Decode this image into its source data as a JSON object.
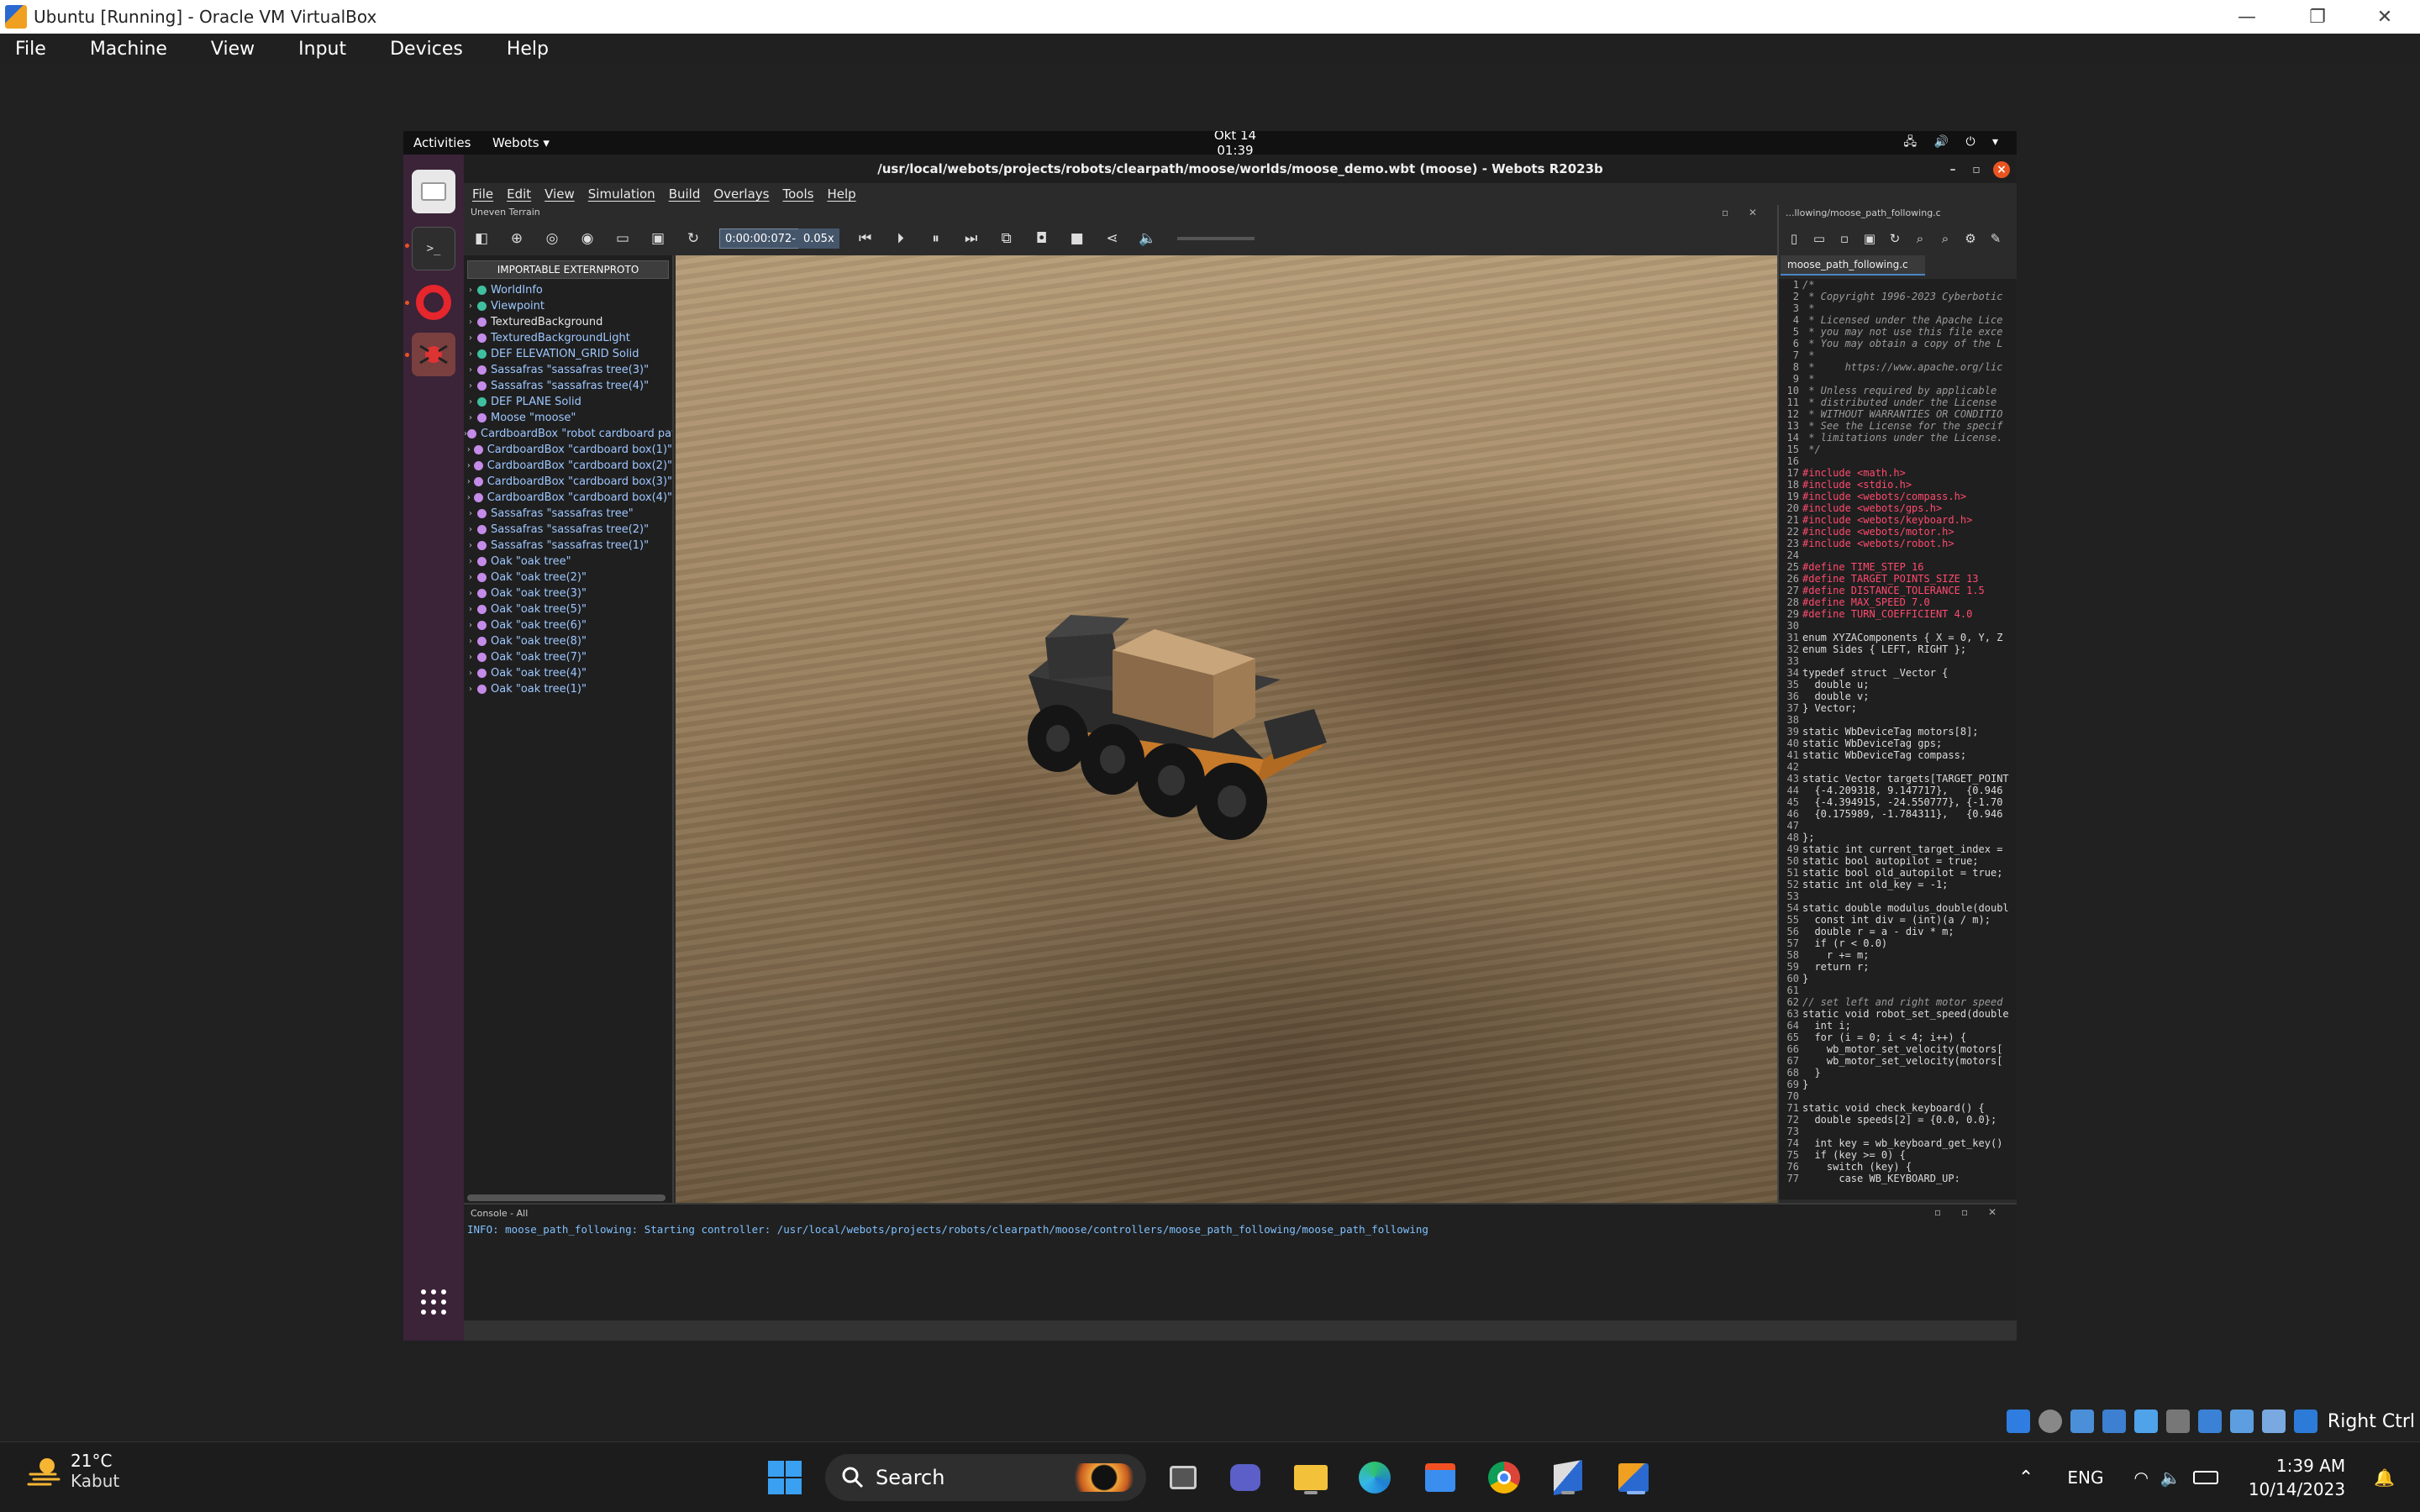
{
  "host": {
    "window_title": "Ubuntu [Running] - Oracle VM VirtualBox",
    "controls": [
      "—",
      "❐",
      "✕"
    ],
    "menu": [
      "File",
      "Machine",
      "View",
      "Input",
      "Devices",
      "Help"
    ],
    "right_ctrl": "Right Ctrl"
  },
  "guest": {
    "activities": "Activities",
    "app_menu": "Webots ▾",
    "clock": "Okt 14  01:39",
    "tray": "🖧 🔊 ⏻ ▾"
  },
  "webots": {
    "title": "/usr/local/webots/projects/robots/clearpath/moose/worlds/moose_demo.wbt (moose) - Webots R2023b",
    "menu": [
      "File",
      "Edit",
      "View",
      "Simulation",
      "Build",
      "Overlays",
      "Tools",
      "Help"
    ],
    "dock_label": "Uneven Terrain",
    "time": "0:00:00:072",
    "time_sep": "-",
    "speed": "0.05x",
    "importable_button": "IMPORTABLE EXTERNPROTO",
    "scene_tree": [
      {
        "label": "WorldInfo",
        "color": "#3fbfa0",
        "plain": false
      },
      {
        "label": "Viewpoint",
        "color": "#3fbfa0",
        "plain": false
      },
      {
        "label": "TexturedBackground",
        "color": "#c58be8",
        "plain": true
      },
      {
        "label": "TexturedBackgroundLight",
        "color": "#c58be8",
        "plain": false
      },
      {
        "label": "DEF ELEVATION_GRID Solid",
        "color": "#3fbfa0",
        "plain": false
      },
      {
        "label": "Sassafras \"sassafras tree(3)\"",
        "color": "#c58be8",
        "plain": false
      },
      {
        "label": "Sassafras \"sassafras tree(4)\"",
        "color": "#c58be8",
        "plain": false
      },
      {
        "label": "DEF PLANE Solid",
        "color": "#3fbfa0",
        "plain": false
      },
      {
        "label": "Moose \"moose\"",
        "color": "#c58be8",
        "plain": false
      },
      {
        "label": "CardboardBox \"robot cardboard pay",
        "color": "#c58be8",
        "plain": false
      },
      {
        "label": "CardboardBox \"cardboard box(1)\"",
        "color": "#c58be8",
        "plain": false
      },
      {
        "label": "CardboardBox \"cardboard box(2)\"",
        "color": "#c58be8",
        "plain": false
      },
      {
        "label": "CardboardBox \"cardboard box(3)\"",
        "color": "#c58be8",
        "plain": false
      },
      {
        "label": "CardboardBox \"cardboard box(4)\"",
        "color": "#c58be8",
        "plain": false
      },
      {
        "label": "Sassafras \"sassafras tree\"",
        "color": "#c58be8",
        "plain": false
      },
      {
        "label": "Sassafras \"sassafras tree(2)\"",
        "color": "#c58be8",
        "plain": false
      },
      {
        "label": "Sassafras \"sassafras tree(1)\"",
        "color": "#c58be8",
        "plain": false
      },
      {
        "label": "Oak \"oak tree\"",
        "color": "#c58be8",
        "plain": false
      },
      {
        "label": "Oak \"oak tree(2)\"",
        "color": "#c58be8",
        "plain": false
      },
      {
        "label": "Oak \"oak tree(3)\"",
        "color": "#c58be8",
        "plain": false
      },
      {
        "label": "Oak \"oak tree(5)\"",
        "color": "#c58be8",
        "plain": false
      },
      {
        "label": "Oak \"oak tree(6)\"",
        "color": "#c58be8",
        "plain": false
      },
      {
        "label": "Oak \"oak tree(8)\"",
        "color": "#c58be8",
        "plain": false
      },
      {
        "label": "Oak \"oak tree(7)\"",
        "color": "#c58be8",
        "plain": false
      },
      {
        "label": "Oak \"oak tree(4)\"",
        "color": "#c58be8",
        "plain": false
      },
      {
        "label": "Oak \"oak tree(1)\"",
        "color": "#c58be8",
        "plain": false
      }
    ],
    "editor": {
      "path": "...llowing/moose_path_following.c",
      "tab": "moose_path_following.c",
      "tab_close": "✕",
      "lines": [
        {
          "n": "1",
          "t": "/*",
          "k": "cm"
        },
        {
          "n": "2",
          "t": " * Copyright 1996-2023 Cyberbotic",
          "k": "cm"
        },
        {
          "n": "3",
          "t": " *",
          "k": "cm"
        },
        {
          "n": "4",
          "t": " * Licensed under the Apache Lice",
          "k": "cm"
        },
        {
          "n": "5",
          "t": " * you may not use this file exce",
          "k": "cm"
        },
        {
          "n": "6",
          "t": " * You may obtain a copy of the L",
          "k": "cm"
        },
        {
          "n": "7",
          "t": " *",
          "k": "cm"
        },
        {
          "n": "8",
          "t": " *     https://www.apache.org/lic",
          "k": "cm"
        },
        {
          "n": "9",
          "t": " *",
          "k": "cm"
        },
        {
          "n": "10",
          "t": " * Unless required by applicable",
          "k": "cm"
        },
        {
          "n": "11",
          "t": " * distributed under the License",
          "k": "cm"
        },
        {
          "n": "12",
          "t": " * WITHOUT WARRANTIES OR CONDITIO",
          "k": "cm"
        },
        {
          "n": "13",
          "t": " * See the License for the specif",
          "k": "cm"
        },
        {
          "n": "14",
          "t": " * limitations under the License.",
          "k": "cm"
        },
        {
          "n": "15",
          "t": " */",
          "k": "cm"
        },
        {
          "n": "16",
          "t": "",
          "k": ""
        },
        {
          "n": "17",
          "t": "#include <math.h>",
          "k": "pp"
        },
        {
          "n": "18",
          "t": "#include <stdio.h>",
          "k": "pp"
        },
        {
          "n": "19",
          "t": "#include <webots/compass.h>",
          "k": "pp"
        },
        {
          "n": "20",
          "t": "#include <webots/gps.h>",
          "k": "pp"
        },
        {
          "n": "21",
          "t": "#include <webots/keyboard.h>",
          "k": "pp"
        },
        {
          "n": "22",
          "t": "#include <webots/motor.h>",
          "k": "pp"
        },
        {
          "n": "23",
          "t": "#include <webots/robot.h>",
          "k": "pp"
        },
        {
          "n": "24",
          "t": "",
          "k": ""
        },
        {
          "n": "25",
          "t": "#define TIME_STEP 16",
          "k": "pp"
        },
        {
          "n": "26",
          "t": "#define TARGET_POINTS_SIZE 13",
          "k": "pp"
        },
        {
          "n": "27",
          "t": "#define DISTANCE_TOLERANCE 1.5",
          "k": "pp"
        },
        {
          "n": "28",
          "t": "#define MAX_SPEED 7.0",
          "k": "pp"
        },
        {
          "n": "29",
          "t": "#define TURN_COEFFICIENT 4.0",
          "k": "pp"
        },
        {
          "n": "30",
          "t": "",
          "k": ""
        },
        {
          "n": "31",
          "t": "enum XYZAComponents { X = 0, Y, Z",
          "k": ""
        },
        {
          "n": "32",
          "t": "enum Sides { LEFT, RIGHT };",
          "k": ""
        },
        {
          "n": "33",
          "t": "",
          "k": ""
        },
        {
          "n": "34",
          "t": "typedef struct _Vector {",
          "k": ""
        },
        {
          "n": "35",
          "t": "  double u;",
          "k": ""
        },
        {
          "n": "36",
          "t": "  double v;",
          "k": ""
        },
        {
          "n": "37",
          "t": "} Vector;",
          "k": ""
        },
        {
          "n": "38",
          "t": "",
          "k": ""
        },
        {
          "n": "39",
          "t": "static WbDeviceTag motors[8];",
          "k": ""
        },
        {
          "n": "40",
          "t": "static WbDeviceTag gps;",
          "k": ""
        },
        {
          "n": "41",
          "t": "static WbDeviceTag compass;",
          "k": ""
        },
        {
          "n": "42",
          "t": "",
          "k": ""
        },
        {
          "n": "43",
          "t": "static Vector targets[TARGET_POINT",
          "k": ""
        },
        {
          "n": "44",
          "t": "  {-4.209318, 9.147717},   {0.946",
          "k": ""
        },
        {
          "n": "45",
          "t": "  {-4.394915, -24.550777}, {-1.70",
          "k": ""
        },
        {
          "n": "46",
          "t": "  {0.175989, -1.784311},   {0.946",
          "k": ""
        },
        {
          "n": "47",
          "t": "",
          "k": ""
        },
        {
          "n": "48",
          "t": "};",
          "k": ""
        },
        {
          "n": "49",
          "t": "static int current_target_index =",
          "k": ""
        },
        {
          "n": "50",
          "t": "static bool autopilot = true;",
          "k": ""
        },
        {
          "n": "51",
          "t": "static bool old_autopilot = true;",
          "k": ""
        },
        {
          "n": "52",
          "t": "static int old_key = -1;",
          "k": ""
        },
        {
          "n": "53",
          "t": "",
          "k": ""
        },
        {
          "n": "54",
          "t": "static double modulus_double(doubl",
          "k": ""
        },
        {
          "n": "55",
          "t": "  const int div = (int)(a / m);",
          "k": ""
        },
        {
          "n": "56",
          "t": "  double r = a - div * m;",
          "k": ""
        },
        {
          "n": "57",
          "t": "  if (r < 0.0)",
          "k": ""
        },
        {
          "n": "58",
          "t": "    r += m;",
          "k": ""
        },
        {
          "n": "59",
          "t": "  return r;",
          "k": ""
        },
        {
          "n": "60",
          "t": "}",
          "k": ""
        },
        {
          "n": "61",
          "t": "",
          "k": ""
        },
        {
          "n": "62",
          "t": "// set left and right motor speed",
          "k": "cm"
        },
        {
          "n": "63",
          "t": "static void robot_set_speed(double",
          "k": ""
        },
        {
          "n": "64",
          "t": "  int i;",
          "k": ""
        },
        {
          "n": "65",
          "t": "  for (i = 0; i < 4; i++) {",
          "k": ""
        },
        {
          "n": "66",
          "t": "    wb_motor_set_velocity(motors[",
          "k": ""
        },
        {
          "n": "67",
          "t": "    wb_motor_set_velocity(motors[",
          "k": ""
        },
        {
          "n": "68",
          "t": "  }",
          "k": ""
        },
        {
          "n": "69",
          "t": "}",
          "k": ""
        },
        {
          "n": "70",
          "t": "",
          "k": ""
        },
        {
          "n": "71",
          "t": "static void check_keyboard() {",
          "k": ""
        },
        {
          "n": "72",
          "t": "  double speeds[2] = {0.0, 0.0};",
          "k": ""
        },
        {
          "n": "73",
          "t": "",
          "k": ""
        },
        {
          "n": "74",
          "t": "  int key = wb_keyboard_get_key()",
          "k": ""
        },
        {
          "n": "75",
          "t": "  if (key >= 0) {",
          "k": ""
        },
        {
          "n": "76",
          "t": "    switch (key) {",
          "k": ""
        },
        {
          "n": "77",
          "t": "      case WB_KEYBOARD_UP:",
          "k": ""
        }
      ]
    },
    "console_title": "Console - All",
    "console_line": "INFO: moose_path_following: Starting controller: /usr/local/webots/projects/robots/clearpath/moose/controllers/moose_path_following/moose_path_following"
  },
  "taskbar": {
    "temp": "21°C",
    "condition": "Kabut",
    "search_label": "Search",
    "lang": "ENG",
    "time": "1:39 AM",
    "date": "10/14/2023",
    "tray_glyphs": "⌃"
  }
}
